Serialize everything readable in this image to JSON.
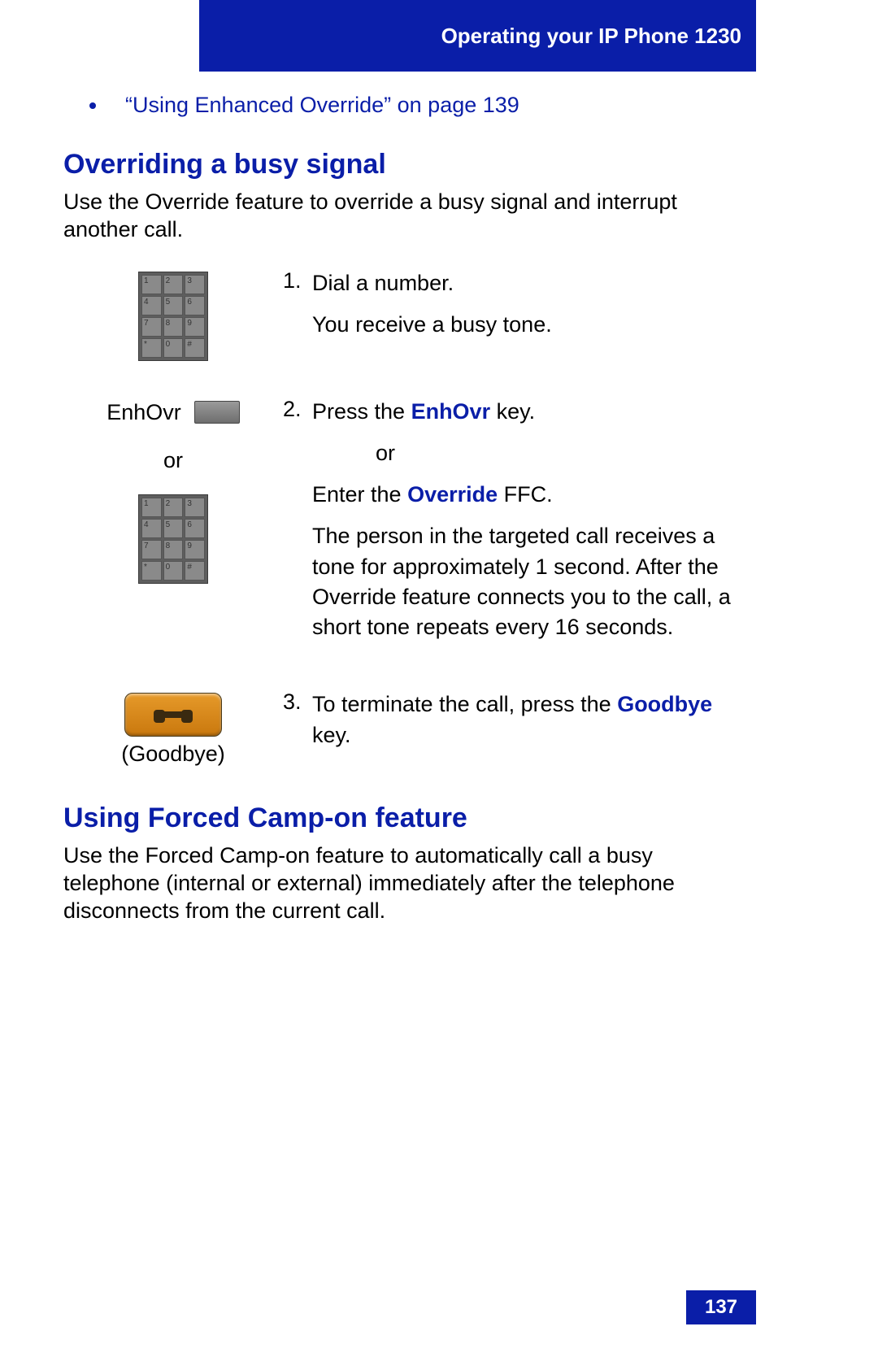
{
  "header": {
    "title": "Operating your IP Phone 1230"
  },
  "bullet": {
    "linkText": "“Using Enhanced Override” on page 139"
  },
  "section1": {
    "heading": "Overriding a busy signal",
    "intro": "Use the Override feature to override a busy signal and interrupt another call."
  },
  "steps": {
    "s1": {
      "num": "1.",
      "line1": "Dial a number.",
      "line2": "You receive a busy tone."
    },
    "labels": {
      "enhovr": "EnhOvr",
      "or": "or",
      "goodbye": "(Goodbye)"
    },
    "s2": {
      "num": "2.",
      "line1_pre": "Press the ",
      "line1_kw": "EnhOvr",
      "line1_post": " key.",
      "line2": "or",
      "line3_pre": "Enter the ",
      "line3_kw": "Override",
      "line3_post": " FFC.",
      "para": "The person in the targeted call receives a tone for approximately 1 second. After the Override feature connects you to the call, a short tone repeats every 16 seconds."
    },
    "s3": {
      "num": "3.",
      "line1_pre": "To terminate the call, press the ",
      "line1_kw": "Goodbye",
      "line1_post": " key."
    }
  },
  "section2": {
    "heading": "Using Forced Camp-on feature",
    "intro": "Use the Forced Camp-on feature to automatically call a busy telephone (internal or external) immediately after the telephone disconnects from the current call."
  },
  "pageNumber": "137",
  "keypadKeys": [
    "1",
    "2",
    "3",
    "4",
    "5",
    "6",
    "7",
    "8",
    "9",
    "*",
    "0",
    "#"
  ]
}
